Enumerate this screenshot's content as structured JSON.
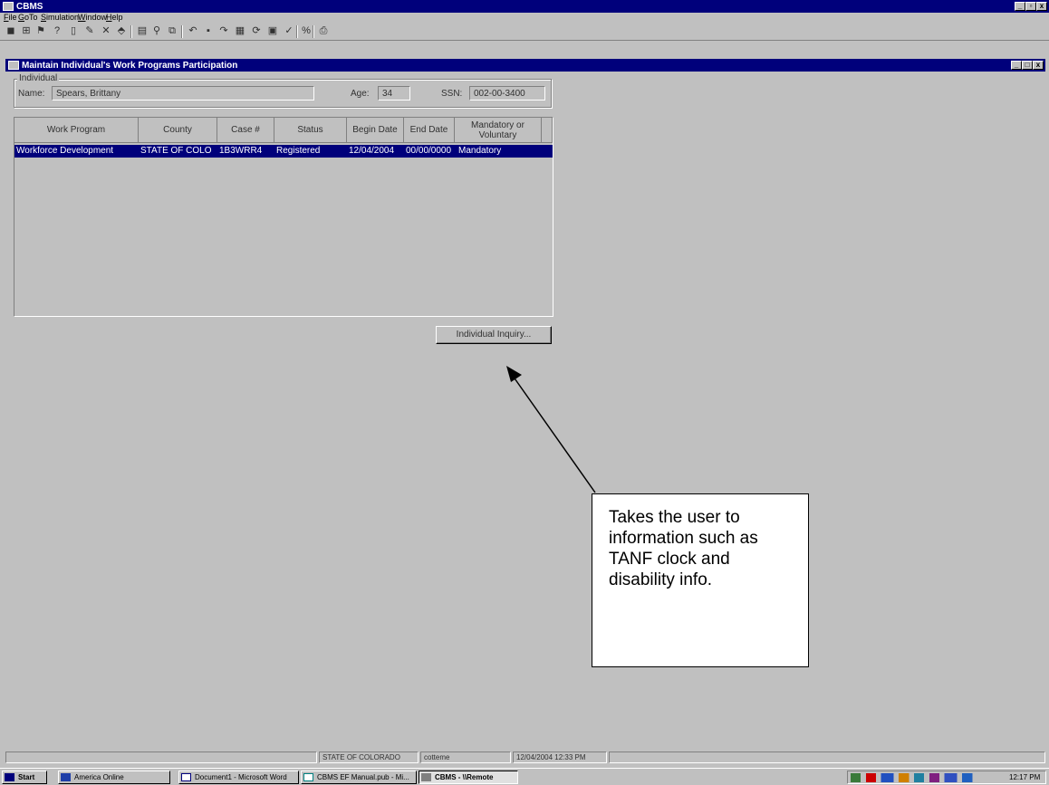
{
  "app": {
    "title": "CBMS",
    "menus": [
      "File",
      "GoTo",
      "Simulation",
      "Window",
      "Help"
    ],
    "window_buttons": [
      "_",
      "▫",
      "x"
    ]
  },
  "child": {
    "title": "Maintain Individual's Work Programs Participation",
    "window_buttons": [
      "_",
      "□",
      "x"
    ]
  },
  "individual": {
    "group_label": "Individual",
    "name_label": "Name:",
    "name_value": "Spears, Brittany",
    "age_label": "Age:",
    "age_value": "34",
    "ssn_label": "SSN:",
    "ssn_value": "002-00-3400"
  },
  "grid": {
    "columns": [
      "Work Program",
      "County",
      "Case #",
      "Status",
      "Begin Date",
      "End Date",
      "Mandatory or Voluntary"
    ],
    "rows": [
      [
        "Workforce Development",
        "STATE OF COLO",
        "1B3WRR4",
        "Registered",
        "12/04/2004",
        "00/00/0000",
        "Mandatory"
      ]
    ]
  },
  "buttons": {
    "individual_inquiry": "Individual Inquiry..."
  },
  "callout": {
    "text": "Takes the user to information such as TANF clock and disability info."
  },
  "status": {
    "county": "STATE OF COLORADO",
    "user": "cotteme",
    "datetime": "12/04/2004 12:33 PM"
  },
  "taskbar": {
    "start": "Start",
    "tasks": [
      "America Online",
      "Document1 - Microsoft Word",
      "CBMS EF Manual.pub - Mi...",
      "CBMS - \\\\Remote"
    ],
    "clock": "12:17 PM"
  },
  "colors": {
    "titlebar": "#00007b",
    "window_face": "#c0c0c0",
    "selection": "#00007b"
  }
}
